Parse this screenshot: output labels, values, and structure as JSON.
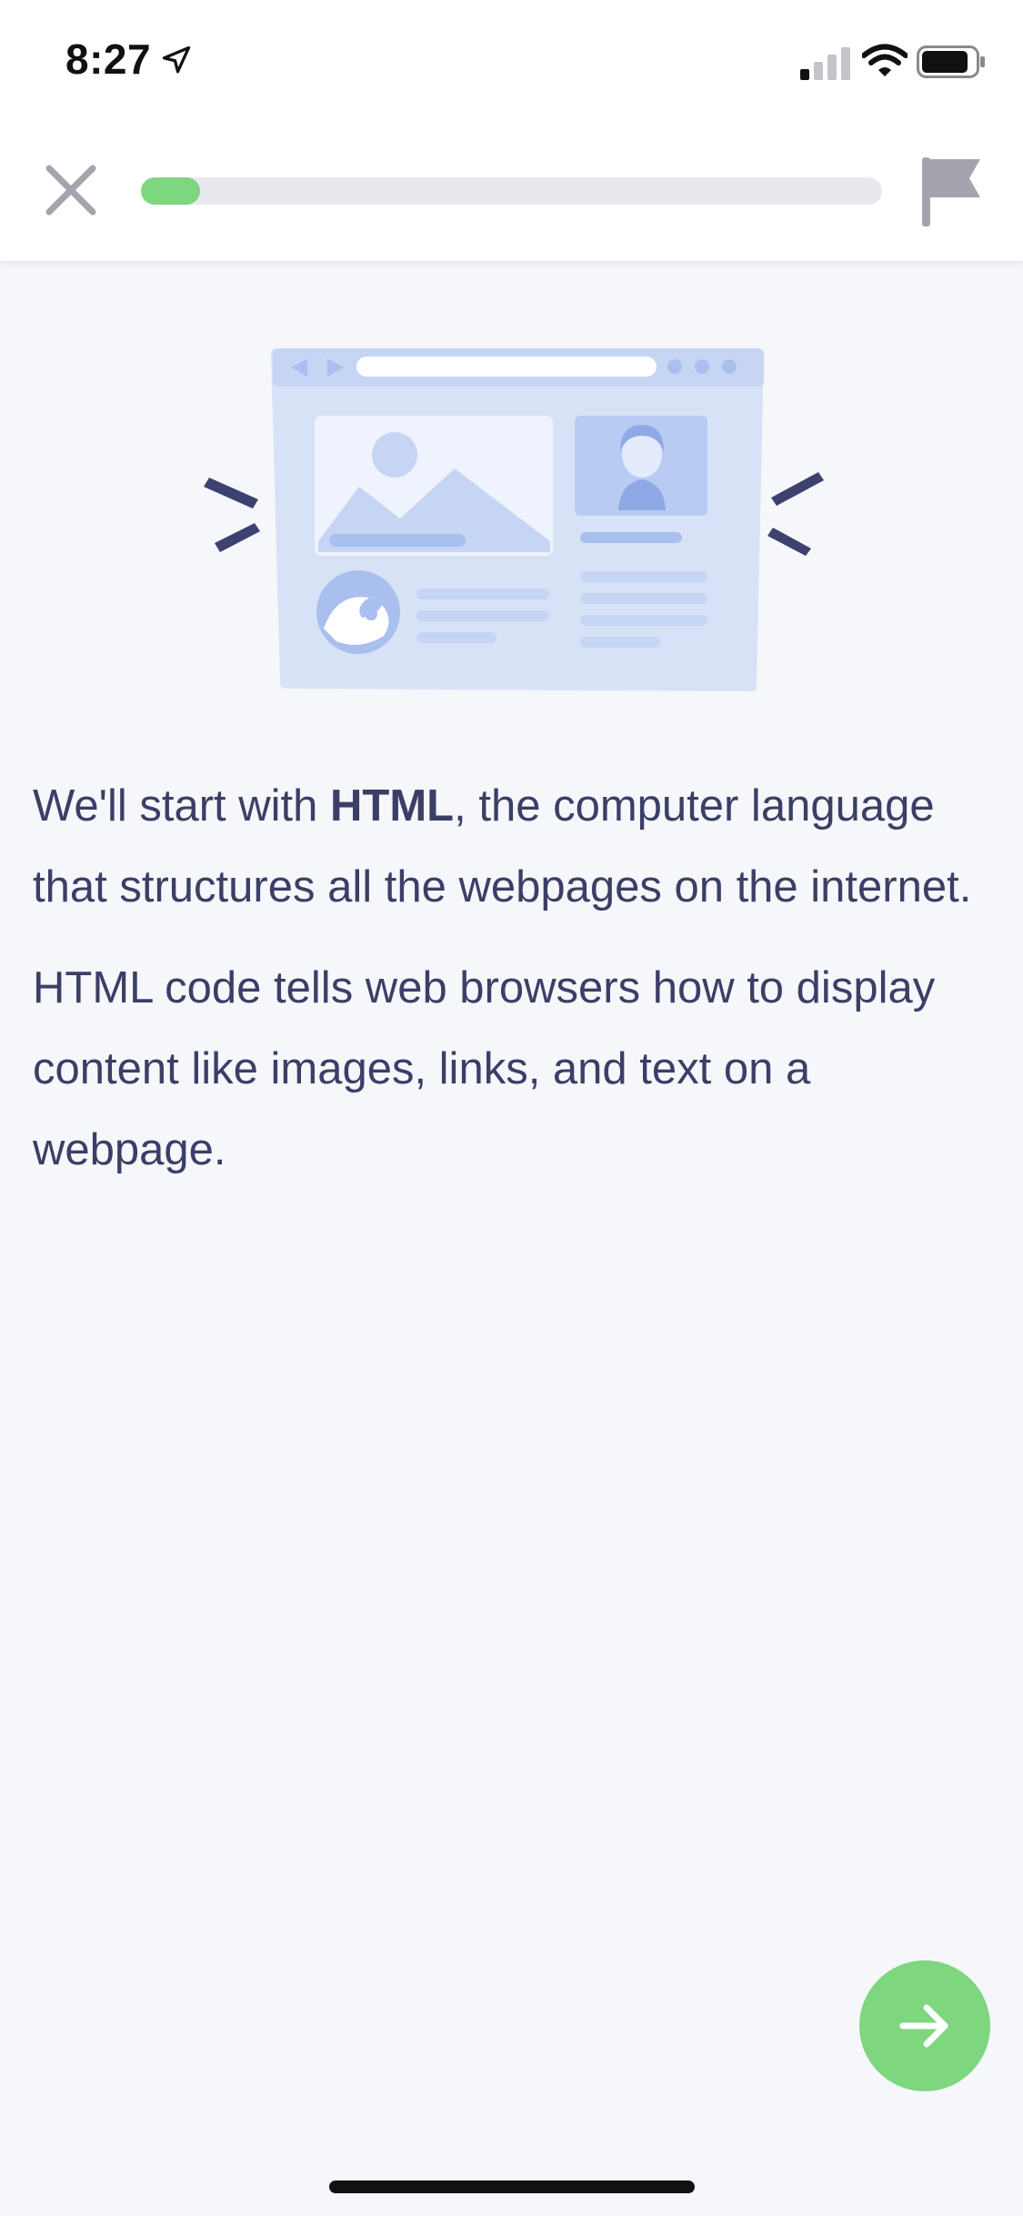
{
  "status_bar": {
    "time": "8:27",
    "location_icon": "location-arrow-icon",
    "signal_icon": "cellular-signal-icon",
    "wifi_icon": "wifi-icon",
    "battery_icon": "battery-icon"
  },
  "header": {
    "close_icon": "close-icon",
    "flag_icon": "flag-icon",
    "progress_fraction": 0.08,
    "progress_color": "#7ed67f"
  },
  "illustration": {
    "name": "webpage-illustration"
  },
  "lesson": {
    "p1_before": "We'll start with ",
    "p1_bold": "HTML",
    "p1_after": ", the computer language that structures all the webpages on the internet.",
    "p2": "HTML code tells web browsers how to display content like images, links, and text on a webpage."
  },
  "next_button": {
    "icon": "arrow-right-icon",
    "color": "#7ed67f"
  },
  "colors": {
    "text": "#3b3f66",
    "accent": "#7ed67f",
    "background": "#f6f7fb"
  }
}
